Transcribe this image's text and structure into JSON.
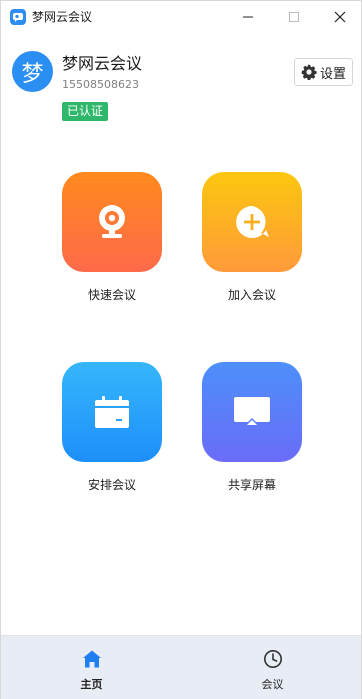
{
  "window": {
    "title": "梦网云会议"
  },
  "profile": {
    "avatar_char": "梦",
    "name": "梦网云会议",
    "phone": "15508508623",
    "badge": "已认证"
  },
  "settings": {
    "label": "设置"
  },
  "actions": [
    {
      "label": "快速会议",
      "icon": "camera-icon"
    },
    {
      "label": "加入会议",
      "icon": "plus-chat-icon"
    },
    {
      "label": "安排会议",
      "icon": "calendar-icon"
    },
    {
      "label": "共享屏幕",
      "icon": "screen-share-icon"
    }
  ],
  "nav": {
    "home": "主页",
    "meeting": "会议"
  },
  "colors": {
    "accent": "#2b8ef2",
    "badge": "#2fb86b"
  }
}
